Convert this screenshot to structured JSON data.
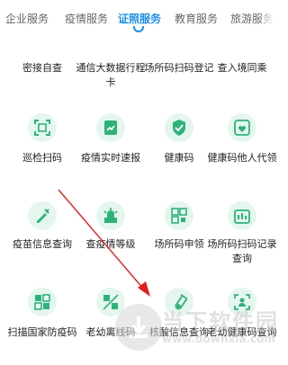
{
  "tabs": [
    {
      "label": "企业服务"
    },
    {
      "label": "疫情服务"
    },
    {
      "label": "证照服务"
    },
    {
      "label": "教育服务"
    },
    {
      "label": "旅游服务"
    }
  ],
  "services": [
    {
      "label": "密接自查",
      "icon": "search-person-icon"
    },
    {
      "label": "通信大数据行程卡",
      "icon": "itinerary-card-icon"
    },
    {
      "label": "场所码扫码登记",
      "icon": "qr-register-icon"
    },
    {
      "label": "查入境同乘",
      "icon": "flight-search-icon"
    },
    {
      "label": "巡检扫码",
      "icon": "scan-icon"
    },
    {
      "label": "疫情实时速报",
      "icon": "report-chart-icon"
    },
    {
      "label": "健康码",
      "icon": "shield-check-icon"
    },
    {
      "label": "健康码他人代领",
      "icon": "health-proxy-icon"
    },
    {
      "label": "疫苗信息查询",
      "icon": "syringe-icon"
    },
    {
      "label": "查疫情等级",
      "icon": "risk-level-icon"
    },
    {
      "label": "场所码申领",
      "icon": "qr-apply-icon"
    },
    {
      "label": "场所码扫码记录查询",
      "icon": "qr-record-icon"
    },
    {
      "label": "扫描国家防疫码",
      "icon": "national-qr-icon"
    },
    {
      "label": "老幼离线码",
      "icon": "offline-code-icon"
    },
    {
      "label": "核酸信息查询",
      "icon": "test-tube-icon"
    },
    {
      "label": "老幼健康码查询",
      "icon": "elder-child-health-icon"
    }
  ],
  "watermark": {
    "name": "当下软件园",
    "url": "www.downxia.com"
  },
  "colors": {
    "accent": "#1d8fe8",
    "icon_bg": "#e4f6ee",
    "icon_fg": "#2fb27a",
    "arrow": "#e02020"
  }
}
